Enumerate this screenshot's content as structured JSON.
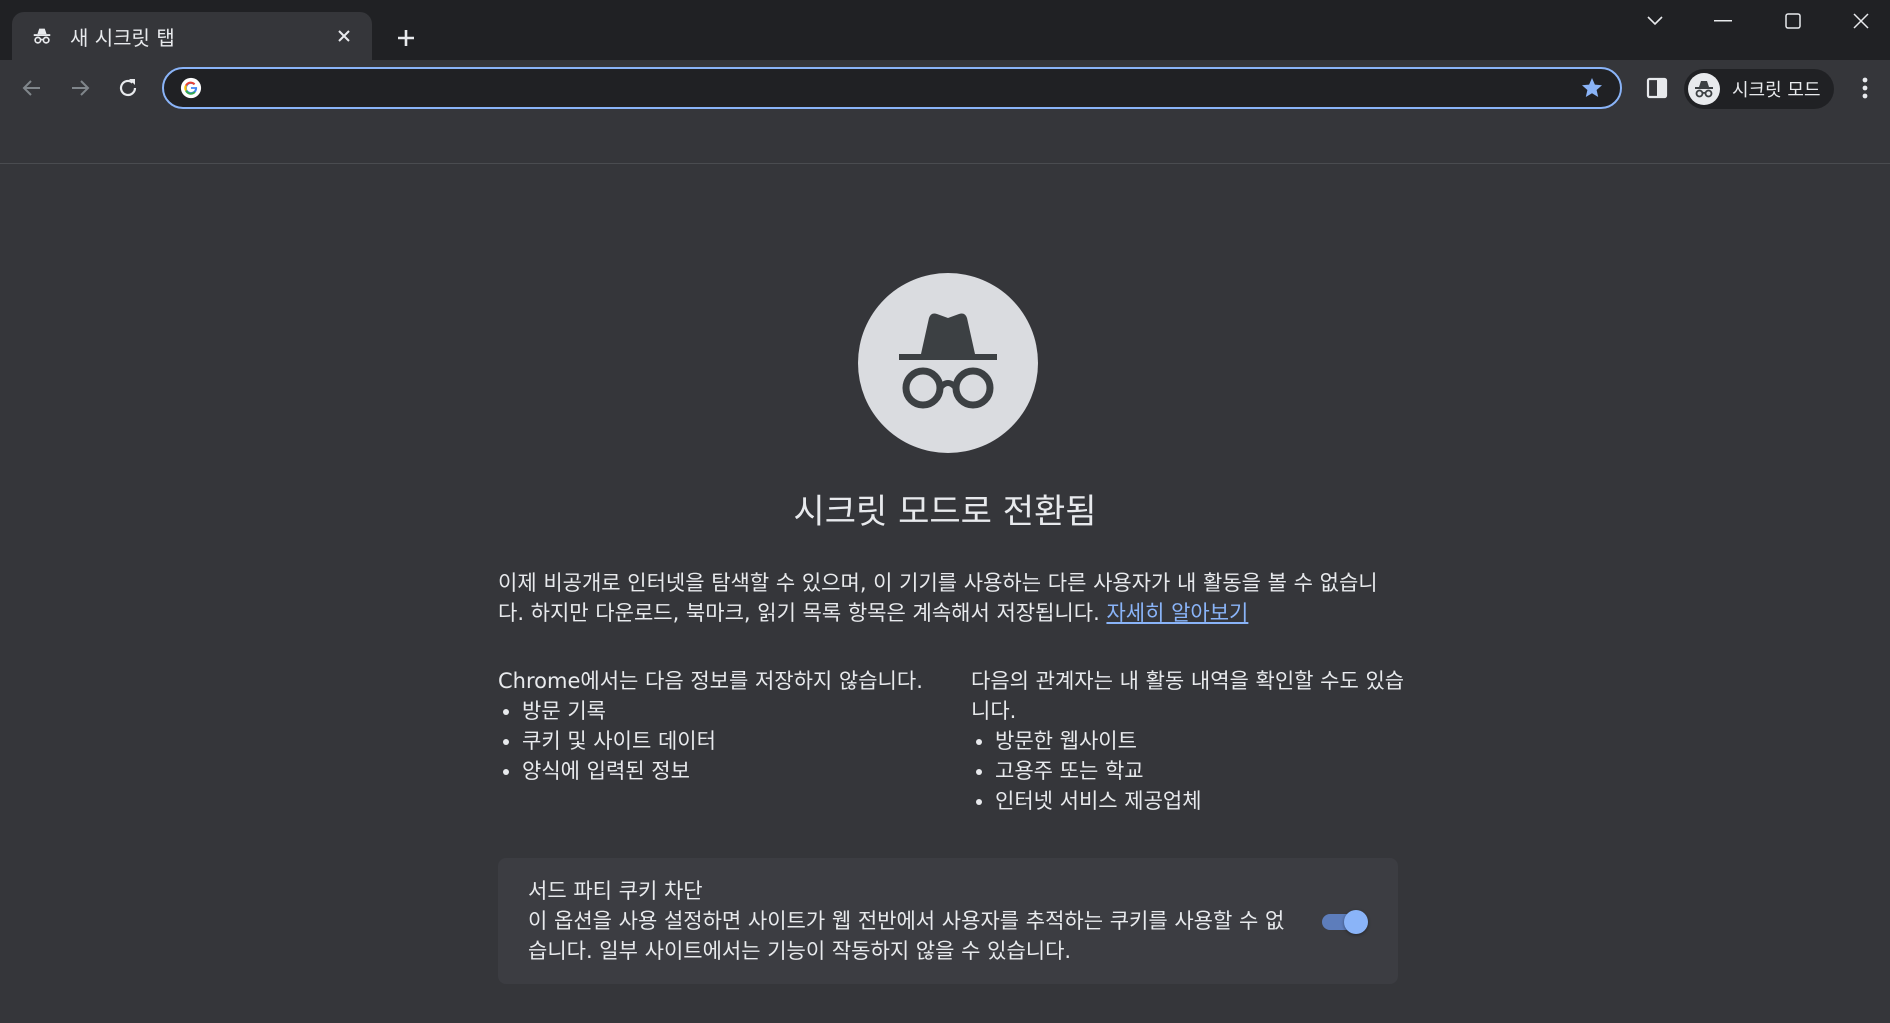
{
  "tab": {
    "title": "새 시크릿 탭"
  },
  "omnibox": {
    "value": "",
    "placeholder": ""
  },
  "profile": {
    "label": "시크릿 모드"
  },
  "page": {
    "title": "시크릿 모드로 전환됨",
    "intro": "이제 비공개로 인터넷을 탐색할 수 있으며, 이 기기를 사용하는 다른 사용자가 내 활동을 볼 수 없습니다. 하지만 다운로드, 북마크, 읽기 목록 항목은 계속해서 저장됩니다.",
    "learn_more": "자세히 알아보기",
    "left_col": {
      "heading": "Chrome에서는 다음 정보를 저장하지 않습니다.",
      "items": [
        "방문 기록",
        "쿠키 및 사이트 데이터",
        "양식에 입력된 정보"
      ]
    },
    "right_col": {
      "heading": "다음의 관계자는 내 활동 내역을 확인할 수도 있습니다.",
      "items": [
        "방문한 웹사이트",
        "고용주 또는 학교",
        "인터넷 서비스 제공업체"
      ]
    },
    "cookie_card": {
      "title": "서드 파티 쿠키 차단",
      "description": "이 옵션을 사용 설정하면 사이트가 웹 전반에서 사용자를 추적하는 쿠키를 사용할 수 없습니다. 일부 사이트에서는 기능이 작동하지 않을 수 있습니다.",
      "enabled": true
    }
  },
  "colors": {
    "frame": "#202124",
    "toolbar": "#35363a",
    "accent": "#8ab4f8",
    "text": "#e8eaed"
  }
}
